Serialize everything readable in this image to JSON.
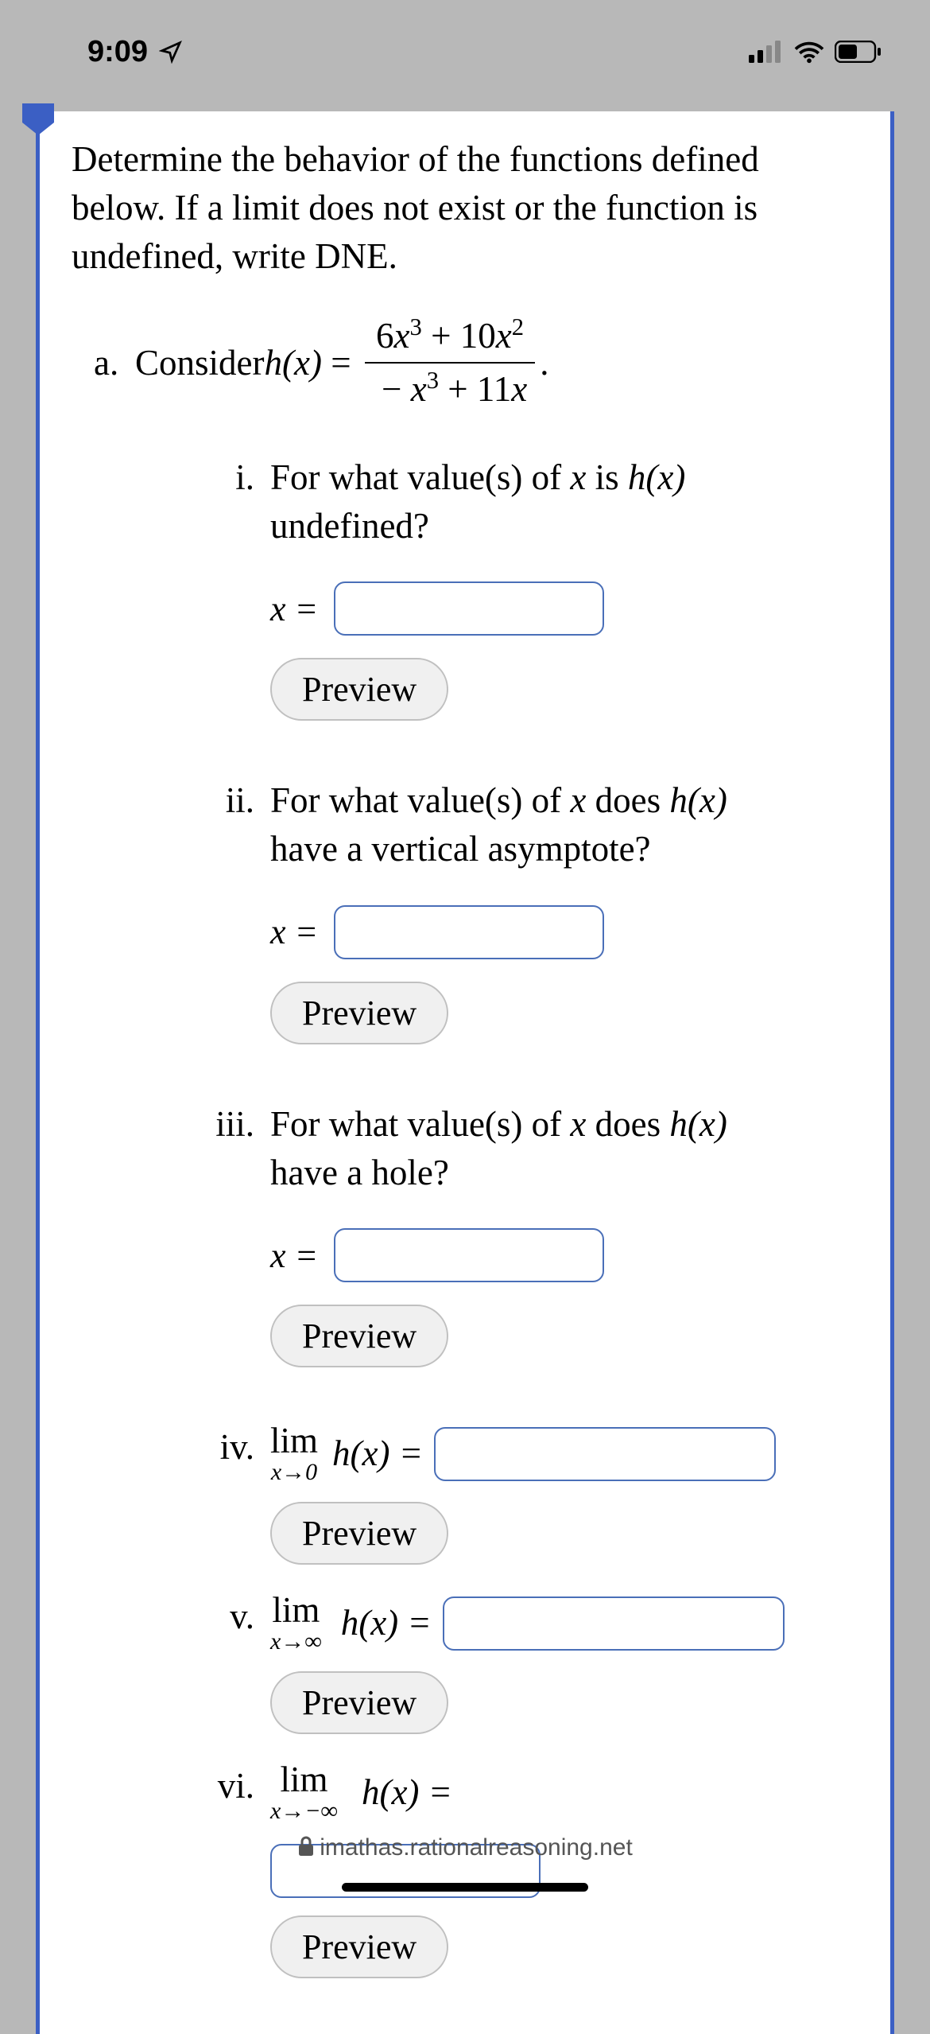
{
  "status": {
    "time": "9:09",
    "location_icon": "location-arrow",
    "signal": "signal-bars",
    "wifi": "wifi",
    "battery": "battery-half"
  },
  "prompt": "Determine the behavior of the functions defined below. If a limit does not exist or the function is undefined, write DNE.",
  "part": {
    "label": "a.",
    "lead": "Consider ",
    "func_lhs": "h(x) = ",
    "numerator": "6x³ + 10x²",
    "denominator": "− x³ + 11x",
    "trailing_dot": "."
  },
  "sub": {
    "i": {
      "num": "i.",
      "text_a": "For what value(s) of ",
      "var": "x",
      "text_b": " is ",
      "func": "h(x)",
      "text_c": " undefined?",
      "xeq": "x =",
      "preview": "Preview"
    },
    "ii": {
      "num": "ii.",
      "text_a": "For what value(s) of ",
      "var": "x",
      "text_b": " does ",
      "func": "h(x)",
      "text_c": " have a vertical asymptote?",
      "xeq": "x =",
      "preview": "Preview"
    },
    "iii": {
      "num": "iii.",
      "text_a": "For what value(s) of ",
      "var": "x",
      "text_b": " does ",
      "func": "h(x)",
      "text_c": " have a hole?",
      "xeq": "x =",
      "preview": "Preview"
    },
    "iv": {
      "num": "iv.",
      "lim_top": "lim",
      "lim_bot": "x→0",
      "func": "h(x) =",
      "preview": "Preview"
    },
    "v": {
      "num": "v.",
      "lim_top": "lim",
      "lim_bot": "x→∞",
      "func": "h(x) =",
      "preview": "Preview"
    },
    "vi": {
      "num": "vi.",
      "lim_top": "lim",
      "lim_bot": "x→−∞",
      "func": "h(x) =",
      "preview": "Preview"
    }
  },
  "footer": {
    "domain": "imathas.rationalreasoning.net"
  }
}
